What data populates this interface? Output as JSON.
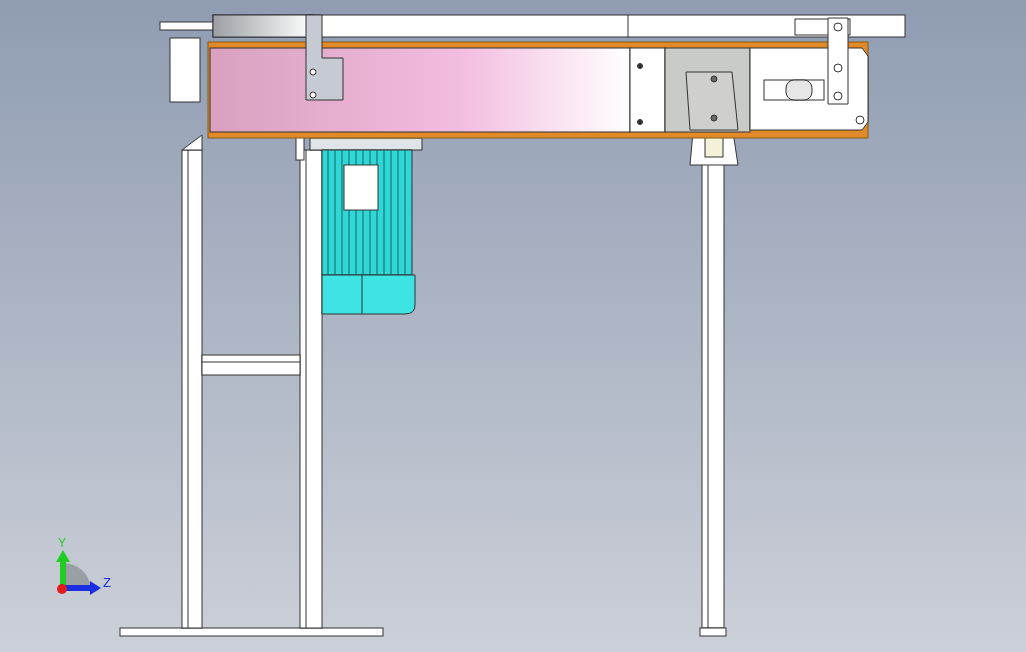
{
  "viewport": {
    "triad": {
      "axes": [
        {
          "label": "Y",
          "kind": "vertical",
          "color": "#22cc22"
        },
        {
          "label": "Z",
          "kind": "horizontal",
          "color": "#1a2ee0"
        }
      ]
    }
  }
}
